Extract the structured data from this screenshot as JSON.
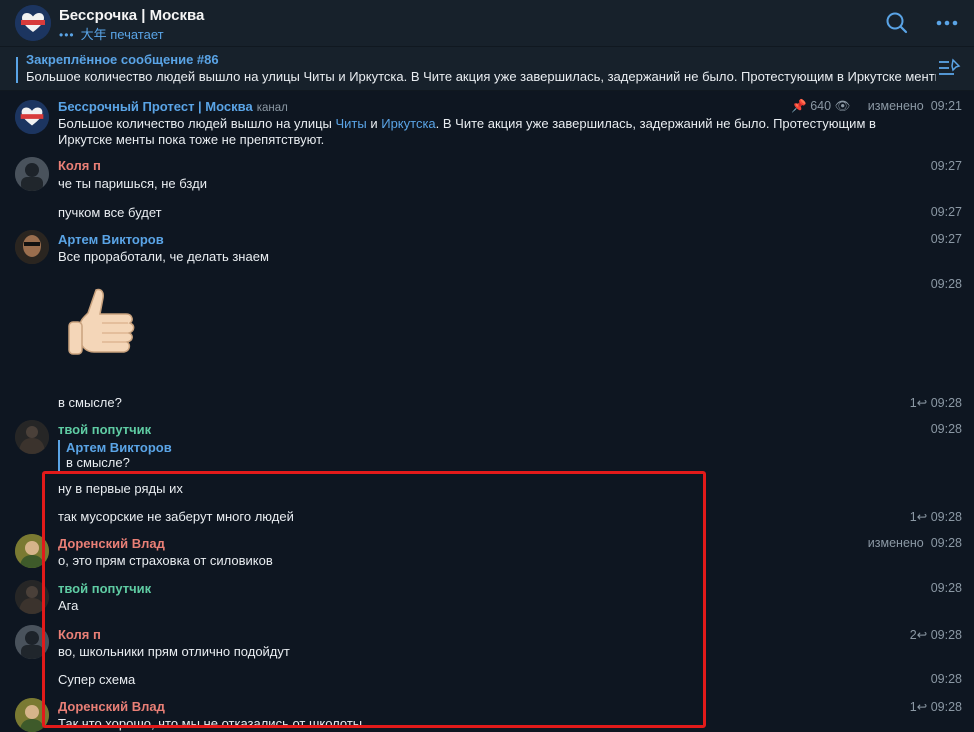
{
  "header": {
    "title": "Бесср​очка | Москва",
    "typing_user": "大年",
    "typing_text": "печатает",
    "icons": {
      "search": "search-icon",
      "more": "more-icon"
    }
  },
  "pinned": {
    "title": "Закреплённое сообщение #86",
    "text": "Большое количество людей вышло на улицы Читы и Иркутска. В Чите акция уже завершилась, задержаний не было. Протестующим в Иркутске менты пока тоже не препятствуют.",
    "icon": "pinned-list-icon"
  },
  "messages": {
    "channel_post": {
      "sender": "Бессрочный Протест | Москва",
      "tag": "канал",
      "line1_a": "Большое количество людей вышло на улицы ",
      "link1": "Читы",
      "line1_b": " и ",
      "link2": "Иркутска",
      "line1_c": ". В Чите акция уже завершилась, задержаний не было. Протестующим в",
      "line2": "Иркутске менты пока тоже не препятствуют.",
      "views": "640",
      "edited": "изменено",
      "time": "09:21"
    },
    "kolya1": {
      "sender": "Коля п",
      "text": "че ты паришься, не бзди",
      "time": "09:27"
    },
    "kolya2": {
      "text": "пучком все будет",
      "time": "09:27"
    },
    "artem1": {
      "sender": "Артем Викторов",
      "text": "Все проработали, че делать знаем",
      "time": "09:27"
    },
    "sticker": {
      "time": "09:28"
    },
    "artem2": {
      "text": "в смысле?",
      "replies": "1",
      "time": "09:28"
    },
    "poputchik1": {
      "sender": "твой попутчик",
      "reply_name": "Артем Викторов",
      "reply_text": "в смысле?",
      "time": "09:28"
    },
    "poputchik2": {
      "text": "ну в первые ряды их"
    },
    "poputchik3": {
      "text": "так  мусорские не заберут много людей",
      "replies": "1",
      "time": "09:28"
    },
    "vlad1": {
      "sender": "Доренский Влад",
      "text": "о, это прям страховка от силовиков",
      "edited": "изменено",
      "time": "09:28"
    },
    "poputchik4": {
      "sender": "твой попутчик",
      "text": "Ага",
      "time": "09:28"
    },
    "kolya3": {
      "sender": "Коля п",
      "text": "во, школьники прям отлично подойдут",
      "replies": "2",
      "time": "09:28"
    },
    "kolya4": {
      "text": "Супер схема",
      "time": "09:28"
    },
    "vlad2": {
      "sender": "Доренский Влад",
      "text": "Так что хорошо, что мы не отказались от школоты",
      "replies": "1",
      "time": "09:28"
    }
  }
}
